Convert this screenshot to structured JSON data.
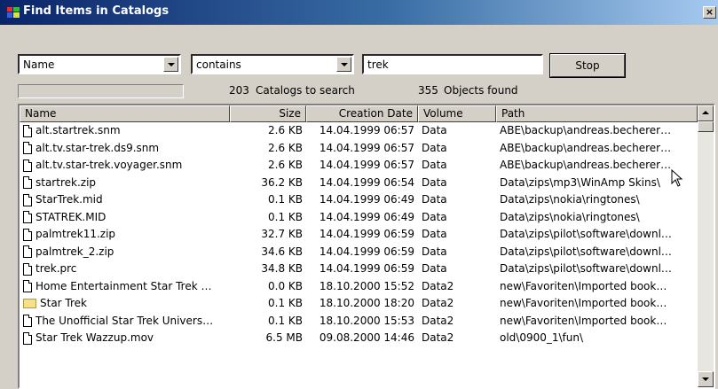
{
  "window": {
    "title": "Find Items in Catalogs",
    "close_label": "×"
  },
  "search": {
    "field_value": "Name",
    "condition_value": "contains",
    "query_value": "trek",
    "stop_label": "Stop"
  },
  "status": {
    "catalogs_count": "203",
    "catalogs_text": "Catalogs to search",
    "objects_count": "355",
    "objects_text": "Objects found"
  },
  "columns": [
    "Name",
    "Size",
    "Creation Date",
    "Volume",
    "Path"
  ],
  "rows": [
    {
      "icon": "file-icon",
      "name": "alt.startrek.snm",
      "size": "2.6 KB",
      "date": "14.04.1999 06:57",
      "volume": "Data",
      "path": "ABE\\backup\\andreas.becherer…"
    },
    {
      "icon": "file-icon",
      "name": "alt.tv.star-trek.ds9.snm",
      "size": "2.6 KB",
      "date": "14.04.1999 06:57",
      "volume": "Data",
      "path": "ABE\\backup\\andreas.becherer…"
    },
    {
      "icon": "file-icon",
      "name": "alt.tv.star-trek.voyager.snm",
      "size": "2.6 KB",
      "date": "14.04.1999 06:57",
      "volume": "Data",
      "path": "ABE\\backup\\andreas.becherer…"
    },
    {
      "icon": "file-icon",
      "name": "startrek.zip",
      "size": "36.2 KB",
      "date": "14.04.1999 06:54",
      "volume": "Data",
      "path": "Data\\zips\\mp3\\WinAmp Skins\\"
    },
    {
      "icon": "file-icon",
      "name": "StarTrek.mid",
      "size": "0.1 KB",
      "date": "14.04.1999 06:49",
      "volume": "Data",
      "path": "Data\\zips\\nokia\\ringtones\\"
    },
    {
      "icon": "file-icon",
      "name": "STATREK.MID",
      "size": "0.1 KB",
      "date": "14.04.1999 06:49",
      "volume": "Data",
      "path": "Data\\zips\\nokia\\ringtones\\"
    },
    {
      "icon": "file-icon",
      "name": "palmtrek11.zip",
      "size": "32.7 KB",
      "date": "14.04.1999 06:59",
      "volume": "Data",
      "path": "Data\\zips\\pilot\\software\\downl…"
    },
    {
      "icon": "file-icon",
      "name": "palmtrek_2.zip",
      "size": "34.6 KB",
      "date": "14.04.1999 06:59",
      "volume": "Data",
      "path": "Data\\zips\\pilot\\software\\downl…"
    },
    {
      "icon": "file-icon",
      "name": "trek.prc",
      "size": "34.8 KB",
      "date": "14.04.1999 06:59",
      "volume": "Data",
      "path": "Data\\zips\\pilot\\software\\downl…"
    },
    {
      "icon": "file-icon",
      "name": "Home Entertainment Star Trek …",
      "size": "0.0 KB",
      "date": "18.10.2000 15:52",
      "volume": "Data2",
      "path": "new\\Favoriten\\Imported book…"
    },
    {
      "icon": "folder-icon",
      "name": "Star Trek",
      "size": "0.1 KB",
      "date": "18.10.2000 18:20",
      "volume": "Data2",
      "path": "new\\Favoriten\\Imported book…"
    },
    {
      "icon": "file-icon",
      "name": "The Unofficial Star Trek Univers…",
      "size": "0.1 KB",
      "date": "18.10.2000 15:53",
      "volume": "Data2",
      "path": "new\\Favoriten\\Imported book…"
    },
    {
      "icon": "file-icon",
      "name": "Star Trek Wazzup.mov",
      "size": "6.5 MB",
      "date": "09.08.2000 14:46",
      "volume": "Data2",
      "path": "old\\0900_1\\fun\\"
    }
  ]
}
